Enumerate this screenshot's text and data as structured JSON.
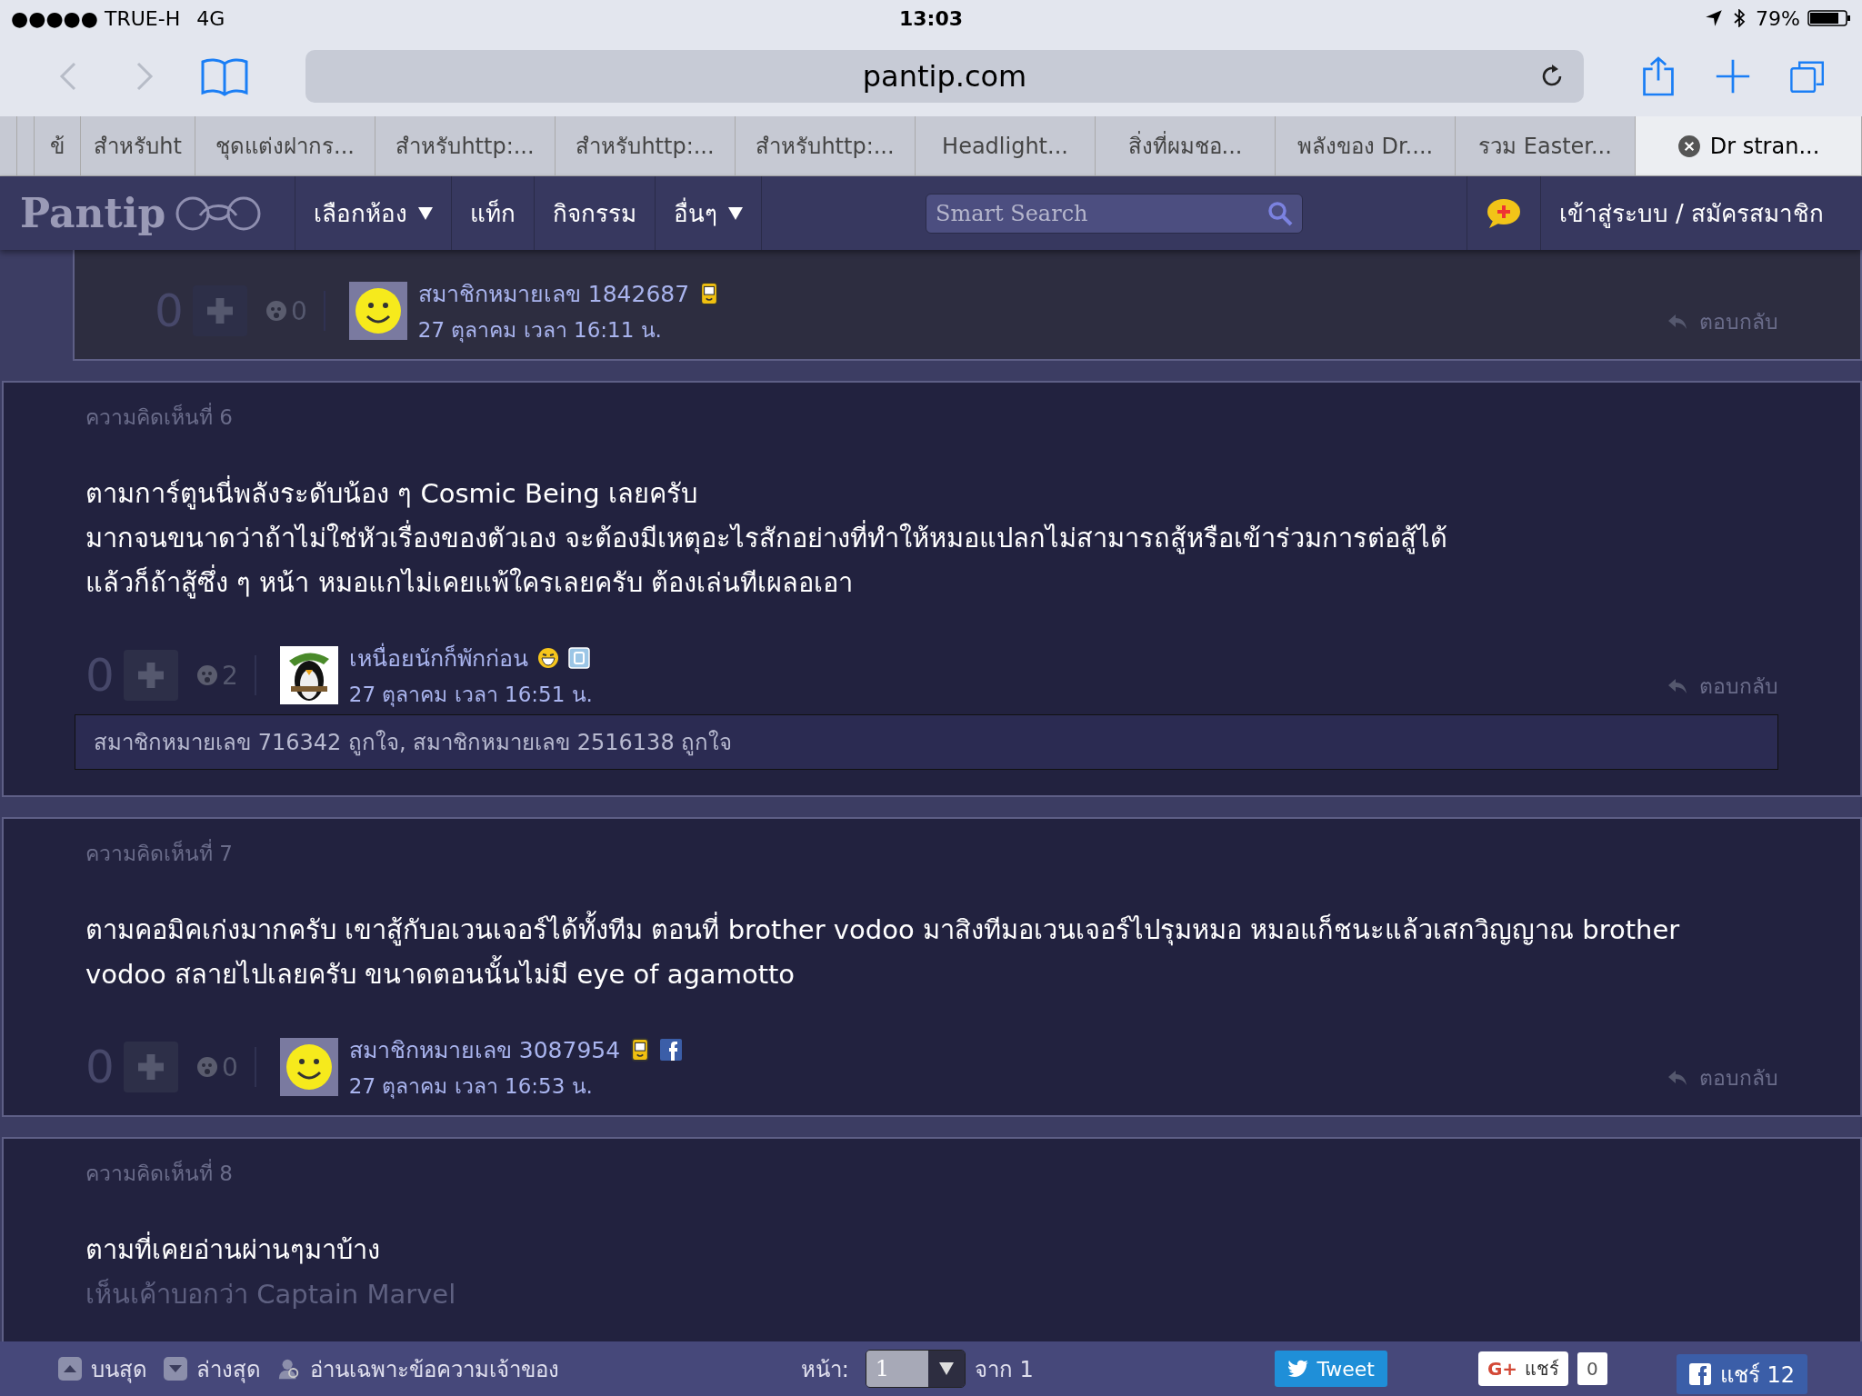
{
  "status_bar": {
    "signal": "●●●●● TRUE-H",
    "network": "4G",
    "time": "13:03",
    "battery": "79%"
  },
  "address_bar": {
    "url": "pantip.com"
  },
  "tabs": [
    {
      "label": "ข้",
      "selected": false
    },
    {
      "label": "สำหรับht",
      "selected": false
    },
    {
      "label": "ชุดแต่งฝากร...",
      "selected": false
    },
    {
      "label": "สำหรับhttp:...",
      "selected": false
    },
    {
      "label": "สำหรับhttp:...",
      "selected": false
    },
    {
      "label": "สำหรับhttp:...",
      "selected": false
    },
    {
      "label": "Headlight...",
      "selected": false
    },
    {
      "label": "สิ่งที่ผมชอ...",
      "selected": false
    },
    {
      "label": "พลังของ Dr....",
      "selected": false
    },
    {
      "label": "รวม Easter...",
      "selected": false
    },
    {
      "label": "Dr stran...",
      "selected": true
    }
  ],
  "site_nav": {
    "logo": "Pantip",
    "menu": [
      {
        "label": "เลือกห้อง",
        "dropdown": true
      },
      {
        "label": "แท็ก",
        "dropdown": false
      },
      {
        "label": "กิจกรรม",
        "dropdown": false
      },
      {
        "label": "อื่นๆ",
        "dropdown": true
      }
    ],
    "search_placeholder": "Smart Search",
    "login": "เข้าสู่ระบบ / สมัครสมาชิก"
  },
  "comments": [
    {
      "kind": "reply",
      "score": "0",
      "emotions": "0",
      "user": "สมาชิกหมายเลข 1842687",
      "date": "27 ตุลาคม เวลา 16:11 น.",
      "avatar": {
        "kind": "smiley"
      },
      "badges": [
        {
          "kind": "mobile"
        }
      ],
      "reply": "ตอบกลับ"
    },
    {
      "kind": "comment",
      "label": "ความคิดเห็นที่ 6",
      "body": [
        "ตามการ์ตูนนี่พลังระดับน้อง ๆ Cosmic Being เลยครับ",
        "มากจนขนาดว่าถ้าไม่ใช่หัวเรื่องของตัวเอง จะต้องมีเหตุอะไรสักอย่างที่ทำให้หมอแปลกไม่สามารถสู้หรือเข้าร่วมการต่อสู้ได้",
        "แล้วก็ถ้าสู้ซึ่ง ๆ หน้า หมอแกไม่เคยแพ้ใครเลยครับ ต้องเล่นทีเผลอเอา"
      ],
      "score": "0",
      "emotions": "2",
      "user": "เหนื่อยนักก็พักก่อน",
      "date": "27 ตุลาคม เวลา 16:51 น.",
      "avatar": {
        "kind": "penguin"
      },
      "badges": [
        {
          "kind": "emoji"
        },
        {
          "kind": "blog"
        }
      ],
      "likes": "สมาชิกหมายเลข 716342 ถูกใจ, สมาชิกหมายเลข 2516138 ถูกใจ",
      "reply": "ตอบกลับ"
    },
    {
      "kind": "comment",
      "label": "ความคิดเห็นที่ 7",
      "body": [
        "ตามคอมิคเก่งมากครับ เขาสู้กับอเวนเจอร์ได้ทั้งทีม ตอนที่ brother vodoo มาสิงทีมอเวนเจอร์ไปรุมหมอ หมอแก็ชนะแล้วเสกวิญญาณ brother vodoo สลายไปเลยครับ ขนาดตอนนั้นไม่มี eye of agamotto"
      ],
      "score": "0",
      "emotions": "0",
      "user": "สมาชิกหมายเลข 3087954",
      "date": "27 ตุลาคม เวลา 16:53 น.",
      "avatar": {
        "kind": "smiley"
      },
      "badges": [
        {
          "kind": "mobile"
        },
        {
          "kind": "facebook"
        }
      ],
      "reply": "ตอบกลับ"
    },
    {
      "kind": "comment",
      "label": "ความคิดเห็นที่ 8",
      "body": [
        "ตามที่เคยอ่านผ่านๆมาบ้าง",
        "เห็นเค้าบอกว่า Captain Marvel"
      ]
    }
  ],
  "bottom_bar": {
    "top": "บนสุด",
    "bottom": "ล่างสุด",
    "owner_only": "อ่านเฉพาะข้อความเจ้าของ",
    "page_label": "หน้า:",
    "page": "1",
    "of": "จาก 1",
    "tweet": "Tweet",
    "gplus_logo": "G+",
    "gplus": "แชร์",
    "gplus_count": "0",
    "fb": "แชร์ 12"
  }
}
